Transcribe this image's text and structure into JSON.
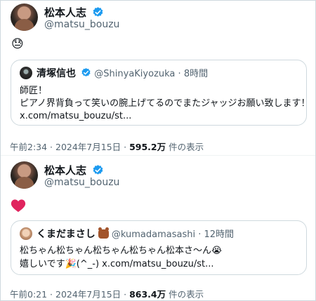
{
  "tweet1": {
    "name": "松本人志",
    "handle": "@matsu_bouzu",
    "emoji": "😓",
    "quote": {
      "name": "清塚信也",
      "handle": "@ShinyaKiyozuka",
      "sep": "·",
      "time": "8時間",
      "line1": "師匠！",
      "line2": "ピアノ界背負って笑いの腕上げてるのでまたジャッジお願い致します！",
      "line3": "x.com/matsu_bouzu/st..."
    },
    "footer": {
      "time": "午前2:34",
      "date": "2024年7月15日",
      "views": "595.2万",
      "views_suffix": "件の表示"
    }
  },
  "tweet2": {
    "name": "松本人志",
    "handle": "@matsu_bouzu",
    "quote": {
      "name": "くまだまさし",
      "handle": "@kumadamasashi",
      "sep": "·",
      "time": "12時間",
      "line1": "松ちゃん松ちゃん松ちゃん松ちゃん松本さ〜ん😭",
      "line2": "嬉しいです🎉(^_-) x.com/matsu_bouzu/st..."
    },
    "footer": {
      "time": "午前0:21",
      "date": "2024年7月15日",
      "views": "863.4万",
      "views_suffix": "件の表示"
    }
  },
  "colors": {
    "verified": "#1d9bf0",
    "heart": "#e0245e",
    "muted": "#536471"
  },
  "icons": {
    "verified": "verified-badge-icon",
    "heart": "heart-icon"
  }
}
